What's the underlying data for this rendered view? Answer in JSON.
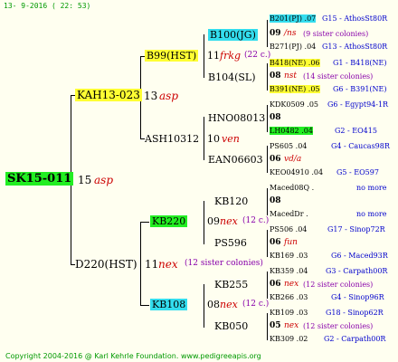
{
  "header": "13-  9-2016 ( 22: 53)",
  "footer": "Copyright 2004-2016 @ Karl Kehrle Foundation.   www.pedigreeapis.org",
  "root": {
    "name": "SK15-011",
    "num": "15",
    "tag": "asp"
  },
  "sire": {
    "name": "KAH13-023",
    "num": "13",
    "tag": "asp"
  },
  "dam": {
    "name": "D220(HST)",
    "num": "11",
    "tag": "nex",
    "sisters": "(12 sister colonies)"
  },
  "gen2": {
    "b99": {
      "name": "B99(HST)",
      "num": "11",
      "tag": "frkg",
      "sisters": "(22 c.)"
    },
    "b104": {
      "name": "B104(SL)"
    },
    "ash": {
      "name": "ASH10312",
      "num": "10",
      "tag": "ven"
    },
    "hno": {
      "name": "HNO08013",
      "num": "8"
    },
    "ean": {
      "name": "EAN06603"
    },
    "kb220": {
      "name": "KB220",
      "num": "09",
      "tag": "nex",
      "sisters": "(12 c.)"
    },
    "kb120": {
      "name": "KB120"
    },
    "ps596": {
      "name": "PS596"
    },
    "kb108": {
      "name": "KB108",
      "num": "08",
      "tag": "nex",
      "sisters": "(12 c.)"
    },
    "kb255": {
      "name": "KB255"
    },
    "kb050": {
      "name": "KB050"
    },
    "b100": {
      "name": "B100(JG)",
      "num": "09",
      "tag": "/ns",
      "sisters": "(9 sister colonies)"
    }
  },
  "right": [
    {
      "id": "B201(PJ) .07",
      "info": "G15 - AthosSt80R"
    },
    {
      "id": "B271(PJ) .04",
      "info": "G13 - AthosSt80R"
    },
    {
      "id": "B418(NE) .06",
      "info": "G1 - B418(NE)"
    },
    {
      "id": "B391(NE) .05",
      "info": "G6 - B391(NE)"
    },
    {
      "id": "KDK0509 .05",
      "info": "G6 - Egypt94-1R"
    },
    {
      "id": "LH0482 .04",
      "info": "G2 - EO415"
    },
    {
      "id": "PS605 .04",
      "info": "G4 - Caucas98R"
    },
    {
      "id": "KEO04910 .04",
      "info": "G5 - EO597"
    },
    {
      "id": "Maced08Q .",
      "info": "no more"
    },
    {
      "id": "MacedDr .",
      "info": "no more"
    },
    {
      "id": "PS506 .04",
      "info": "G17 - Sinop72R"
    },
    {
      "id": "KB169 .03",
      "info": "G6 - Maced93R"
    },
    {
      "id": "KB359 .04",
      "info": "G3 - Carpath00R"
    },
    {
      "id": "KB266 .03",
      "info": "G4 - Sinop96R"
    },
    {
      "id": "KB109 .03",
      "info": "G18 - Sinop62R"
    },
    {
      "id": "KB309 .02",
      "info": "G2 - Carpath00R"
    }
  ],
  "mid": [
    {
      "num": "08",
      "tag": "nst",
      "sisters": "(14 sister colonies)"
    },
    {
      "num": "08"
    },
    {
      "num": "06",
      "tag": "vd/a"
    },
    {
      "num": "08"
    },
    {
      "num": "06",
      "tag": "fun"
    },
    {
      "num": "06",
      "tag": "nex",
      "sisters": "(12 sister colonies)"
    },
    {
      "num": "05",
      "tag": "nex",
      "sisters": "(12 sister colonies)"
    }
  ]
}
